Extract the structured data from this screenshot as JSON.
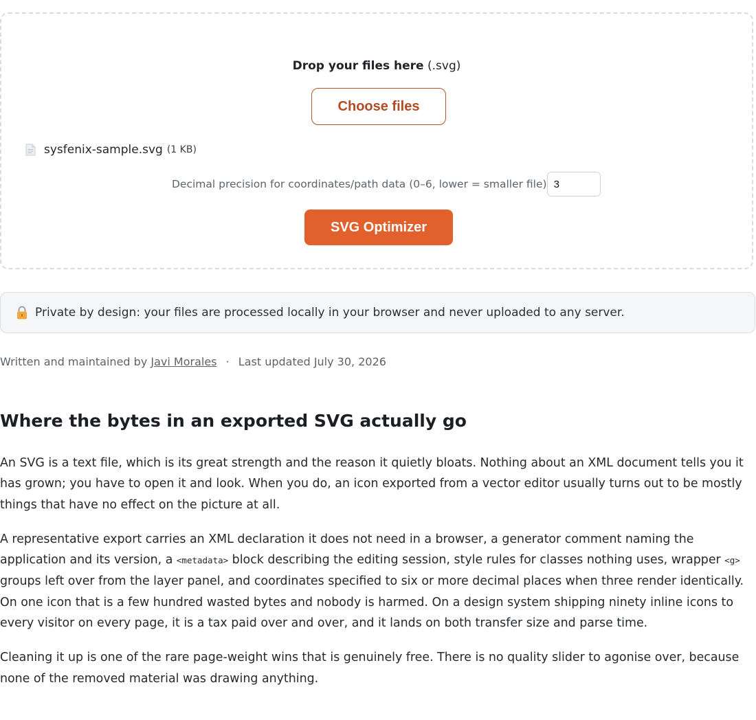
{
  "uploader": {
    "drop_title_bold": "Drop your files here",
    "drop_title_ext": "(.svg)",
    "choose_label": "Choose files",
    "file": {
      "name": "sysfenix-sample.svg",
      "size": "(1 KB)"
    },
    "precision_label": "Decimal precision for coordinates/path data (0–6, lower = smaller file)",
    "precision_value": "3",
    "optimize_label": "SVG Optimizer"
  },
  "privacy": {
    "icon": "lock-icon",
    "text": "Private by design: your files are processed locally in your browser and never uploaded to any server."
  },
  "byline": {
    "prefix": "Written and maintained by",
    "author": "Javi Morales",
    "separator": "·",
    "updated": "Last updated July 30, 2026"
  },
  "article": {
    "title": "Where the bytes in an exported SVG actually go",
    "p1": "An SVG is a text file, which is its great strength and the reason it quietly bloats. Nothing about an XML document tells you it has grown; you have to open it and look. When you do, an icon exported from a vector editor usually turns out to be mostly things that have no effect on the picture at all.",
    "p2_a": "A representative export carries an XML declaration it does not need in a browser, a generator comment naming the application and its version, a ",
    "p2_code1": "<metadata>",
    "p2_b": " block describing the editing session, style rules for classes nothing uses, wrapper ",
    "p2_code2": "<g>",
    "p2_c": " groups left over from the layer panel, and coordinates specified to six or more decimal places when three render identically. On one icon that is a few hundred wasted bytes and nobody is harmed. On a design system shipping ninety inline icons to every visitor on every page, it is a tax paid over and over, and it lands on both transfer size and parse time.",
    "p3": "Cleaning it up is one of the rare page-weight wins that is genuinely free. There is no quality slider to agonise over, because none of the removed material was drawing anything."
  },
  "colors": {
    "accent": "#e1602b",
    "accent_outline": "#b75229"
  }
}
